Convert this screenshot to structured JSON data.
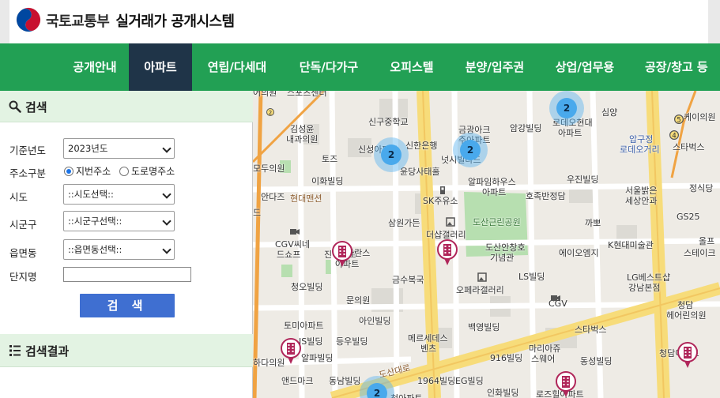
{
  "header": {
    "ministry": "국토교통부",
    "system_name": "실거래가 공개시스템"
  },
  "nav": {
    "tabs": [
      {
        "label": "공개안내",
        "active": false
      },
      {
        "label": "아파트",
        "active": true
      },
      {
        "label": "연립/다세대",
        "active": false
      },
      {
        "label": "단독/다가구",
        "active": false
      },
      {
        "label": "오피스텔",
        "active": false
      },
      {
        "label": "분양/입주권",
        "active": false
      },
      {
        "label": "상업/업무용",
        "active": false
      },
      {
        "label": "공장/창고 등",
        "active": false
      }
    ]
  },
  "search": {
    "title": "검색",
    "year_label": "기준년도",
    "year_value": "2023년도",
    "type_label": "주소구분",
    "type_option_1": "지번주소",
    "type_option_2": "도로명주소",
    "type_selected": "지번주소",
    "sido_label": "시도",
    "sido_value": "::시도선택::",
    "sigungu_label": "시군구",
    "sigungu_value": "::시군구선택::",
    "eup_label": "읍면동",
    "eup_value": "::읍면동선택::",
    "apt_label": "단지명",
    "apt_value": "",
    "button": "검 색"
  },
  "results": {
    "title": "검색결과"
  },
  "colors": {
    "nav_bg": "#22a054",
    "nav_active": "#1f3448",
    "button": "#3f6fd1",
    "section_head": "#e3f3e3",
    "cluster": "#49a9ec",
    "marker": "#b0265a"
  },
  "map": {
    "labels": [
      "스포츠센터",
      "신구중학교",
      "김성윤",
      "내과의원",
      "신성아파트",
      "신한은행",
      "금광아크",
      "주아파트",
      "암강빌딩",
      "로데오현대",
      "아파트",
      "심양",
      "압구정",
      "로데오거리",
      "스타벅스",
      "모두의원",
      "토즈",
      "윤당사태홀",
      "넛시빌라드",
      "이화빌딩",
      "알파임하우스",
      "아파트",
      "우진빌딩",
      "현대맨션",
      "안다즈",
      "SK주유소",
      "호족반정담",
      "서울밝은",
      "세상안과",
      "정식당",
      "GS25",
      "드",
      "삼원가든",
      "도산근린공원",
      "까뽀",
      "더샵갤러리",
      "CGV씨네",
      "드쇼프",
      "진아파트",
      "마란스",
      "아파트",
      "도산안창호",
      "기념관",
      "에이오엠지",
      "K현대미술관",
      "올프",
      "스테이크",
      "청오빌딩",
      "금수복국",
      "LS빌딩",
      "LG베스트샵",
      "강남본점",
      "오페라갤러리",
      "문의원",
      "CGV",
      "청담",
      "헤어린의원",
      "토미아파트",
      "아인빌딩",
      "백영빌딩",
      "메르세데스",
      "벤츠",
      "스타벅스",
      "JS빌딩",
      "등우빌딩",
      "마리아쥬",
      "스웨어",
      "916빌딩",
      "알파빌딩",
      "동성빌딩",
      "청담아파트",
      "하다의원",
      "앤드마크",
      "동남빌딩",
      "1964빌딩",
      "EG빌딩",
      "인화빌딩",
      "로즈힐아파트",
      "도산대로",
      "청아파트",
      "어의원",
      "케이의원"
    ],
    "clusters": [
      {
        "count": "2"
      },
      {
        "count": "2"
      },
      {
        "count": "2"
      },
      {
        "count": "2"
      }
    ],
    "marker_icon": "apartment-marker-icon"
  }
}
